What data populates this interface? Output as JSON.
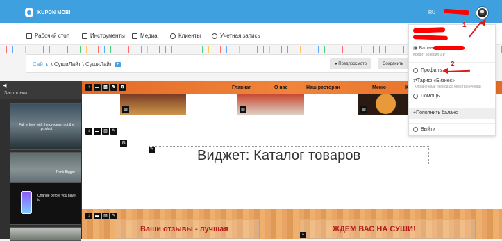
{
  "app": {
    "logo_text": "KUPON MOBI",
    "language": "RU"
  },
  "navigation": {
    "items": [
      {
        "label": "Рабочий стол",
        "icon": "dashboard-icon"
      },
      {
        "label": "Инструменты",
        "icon": "tools-icon"
      },
      {
        "label": "Медиа",
        "icon": "media-icon"
      },
      {
        "label": "Клиенты",
        "icon": "clients-icon"
      },
      {
        "label": "Учетная запись",
        "icon": "account-icon"
      }
    ]
  },
  "editor": {
    "breadcrumb_link": "Сайты",
    "breadcrumb_path": " \\ СушиЛайт \\ СушиЛайт",
    "preview_label": "Предпросмотр",
    "save_label": "Сохранить"
  },
  "sidebar": {
    "heading": "Заголовки",
    "thumb_text_1": "Fall in love with the process, not the product",
    "thumb_text_2": "Think Bigger",
    "thumb_text_3": "Change before you have to"
  },
  "site": {
    "menu": [
      "Главная",
      "О нас",
      "Наш ресторан",
      "Меню",
      "К"
    ],
    "widget_title": "Виджет: Каталог товаров",
    "reviews_title": "Ваши отзывы - лучшая",
    "wait_title": "ЖДЕМ ВАС НА СУШИ!"
  },
  "account_menu": {
    "balance_label": "Баланс",
    "credit_text": "Кредит доверия 0 ₽",
    "profile_label": "Профиль",
    "plan_label": "Тариф «Бизнес»",
    "plan_subtext": "Оплаченный период до без ограничений",
    "help_label": "Помощь",
    "topup_label": "Пополнить баланс",
    "logout_label": "Выйти",
    "annotation_1": "1",
    "annotation_2": "2"
  },
  "colors": {
    "topbar": "#3fa0df",
    "accent": "#e11919",
    "site_menu": "#e46b26"
  }
}
